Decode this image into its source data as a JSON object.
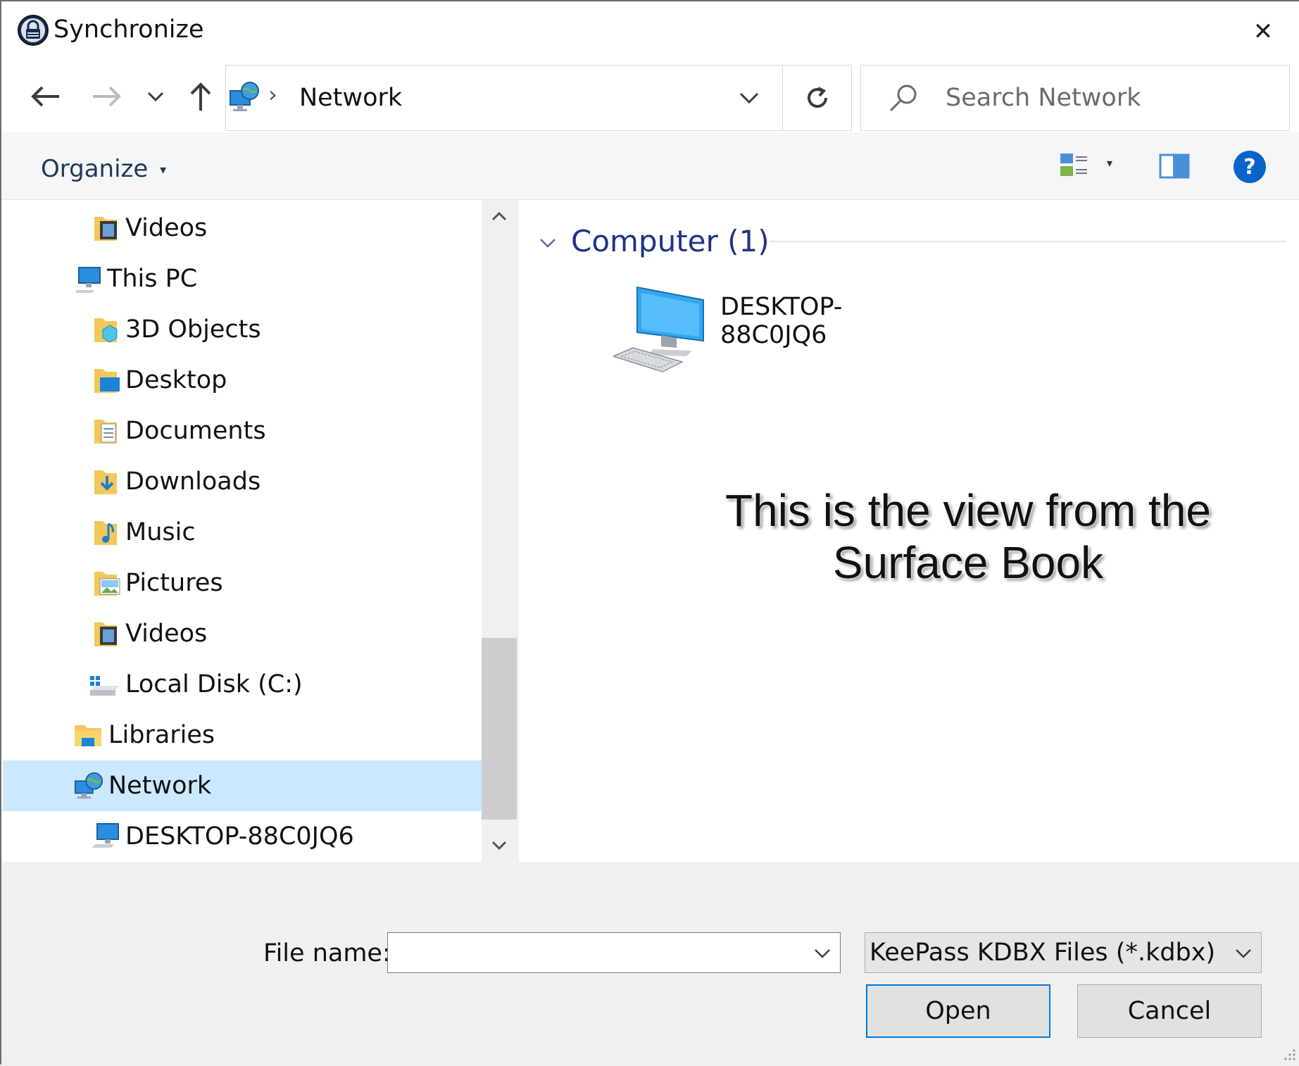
{
  "window": {
    "title": "Synchronize",
    "close_glyph": "✕"
  },
  "nav": {
    "back_icon": "back-arrow-icon",
    "forward_icon": "forward-arrow-icon",
    "recent_icon": "chevron-down-icon",
    "up_icon": "up-arrow-icon",
    "address_path": "Network",
    "address_separator": "›",
    "refresh_icon": "refresh-icon",
    "search_placeholder": "Search Network"
  },
  "commandbar": {
    "organize_label": "Organize",
    "organize_caret": "▾",
    "view_caret": "▾",
    "help_glyph": "?"
  },
  "tree": {
    "items": [
      {
        "label": "Videos",
        "icon": "videos-folder-icon",
        "level": 2,
        "selected": false
      },
      {
        "label": "This PC",
        "icon": "this-pc-icon",
        "level": 1,
        "selected": false
      },
      {
        "label": "3D Objects",
        "icon": "3d-objects-folder-icon",
        "level": 2,
        "selected": false
      },
      {
        "label": "Desktop",
        "icon": "desktop-folder-icon",
        "level": 2,
        "selected": false
      },
      {
        "label": "Documents",
        "icon": "documents-folder-icon",
        "level": 2,
        "selected": false
      },
      {
        "label": "Downloads",
        "icon": "downloads-folder-icon",
        "level": 2,
        "selected": false
      },
      {
        "label": "Music",
        "icon": "music-folder-icon",
        "level": 2,
        "selected": false
      },
      {
        "label": "Pictures",
        "icon": "pictures-folder-icon",
        "level": 2,
        "selected": false
      },
      {
        "label": "Videos",
        "icon": "videos-folder-icon",
        "level": 2,
        "selected": false
      },
      {
        "label": "Local Disk (C:)",
        "icon": "local-disk-icon",
        "level": 2,
        "selected": false
      },
      {
        "label": "Libraries",
        "icon": "libraries-icon",
        "level": 1,
        "selected": false
      },
      {
        "label": "Network",
        "icon": "network-icon",
        "level": 1,
        "selected": true
      },
      {
        "label": "DESKTOP-88C0JQ6",
        "icon": "computer-icon",
        "level": 2,
        "selected": false
      }
    ]
  },
  "content": {
    "group_header": "Computer (1)",
    "items": [
      {
        "name": "DESKTOP-88C0JQ6",
        "icon": "computer-icon"
      }
    ],
    "annotation_line1": "This is the view from the",
    "annotation_line2": "Surface Book"
  },
  "footer": {
    "filename_label": "File name:",
    "filename_value": "",
    "filetype_value": "KeePass KDBX Files (*.kdbx)",
    "open_label": "Open",
    "cancel_label": "Cancel"
  },
  "colors": {
    "selection": "#cce8ff",
    "header_blue": "#1e3287",
    "accent": "#0078d7",
    "panel": "#f0f0f0"
  }
}
